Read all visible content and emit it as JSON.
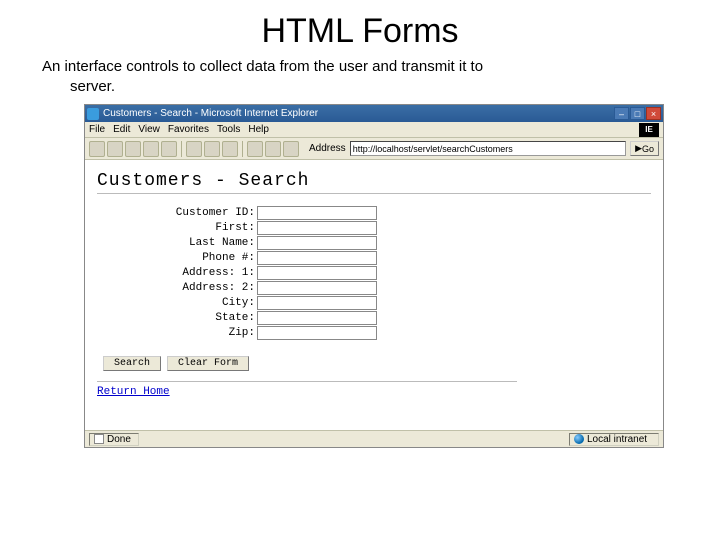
{
  "slide": {
    "title": "HTML Forms",
    "body_line1": "An interface controls to collect data from the user and transmit it to",
    "body_line2": "server."
  },
  "window": {
    "title": "Customers - Search - Microsoft Internet Explorer",
    "menus": [
      "File",
      "Edit",
      "View",
      "Favorites",
      "Tools",
      "Help"
    ],
    "throbber": "IE",
    "address_label": "Address",
    "address_value": "http://localhost/servlet/searchCustomers",
    "go_label": "Go"
  },
  "page": {
    "heading": "Customers - Search",
    "fields": [
      "Customer ID:",
      "First:",
      "Last Name:",
      "Phone #:",
      "Address: 1:",
      "Address: 2:",
      "City:",
      "State:",
      "Zip:"
    ],
    "buttons": {
      "search": "Search",
      "clear": "Clear Form"
    },
    "return_link": "Return Home"
  },
  "status": {
    "done": "Done",
    "zone": "Local intranet"
  }
}
